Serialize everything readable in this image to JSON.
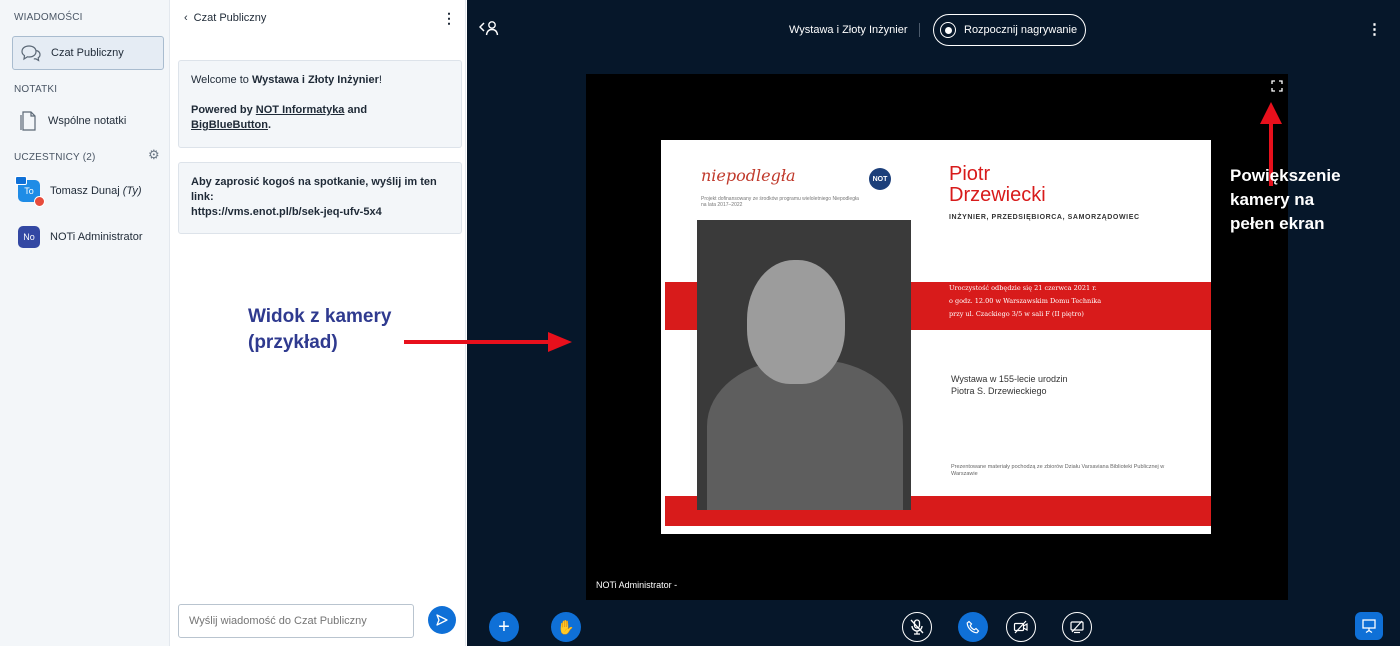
{
  "sidebar": {
    "messages_title": "WIADOMOŚCI",
    "public_chat_label": "Czat Publiczny",
    "notes_title": "NOTATKI",
    "shared_notes_label": "Wspólne notatki",
    "participants_title": "UCZESTNICY (2)",
    "participants": [
      {
        "initials": "To",
        "name": "Tomasz Dunaj",
        "suffix": "(Ty)",
        "color": "#1f8ce6"
      },
      {
        "initials": "No",
        "name": "NOTi Administrator",
        "suffix": "",
        "color": "#3348a3"
      }
    ]
  },
  "chat": {
    "header": "Czat Publiczny",
    "welcome_prefix": "Welcome to ",
    "welcome_name": "Wystawa i Złoty Inżynier",
    "welcome_suffix": "!",
    "powered_prefix": "Powered by ",
    "powered_link1": "NOT Informatyka",
    "powered_and": " and",
    "powered_link2": "BigBlueButton",
    "powered_end": ".",
    "invite_text": "Aby zaprosić kogoś na spotkanie, wyślij im ten link:",
    "invite_link": "https://vms.enot.pl/b/sek-jeq-ufv-5x4",
    "input_placeholder": "Wyślij wiadomość do Czat Publiczny"
  },
  "main": {
    "meeting_title": "Wystawa i Złoty Inżynier",
    "record_label": "Rozpocznij nagrywanie",
    "camera_label": "NOTi Administrator -"
  },
  "slide": {
    "logo_script": "niepodległa",
    "logo_sub": "Projekt dofinansowany ze środków programu wieloletniego Niepodległa na lata 2017–2022",
    "badge": "NOT",
    "name_line1": "Piotr",
    "name_line2": "Drzewiecki",
    "role": "INŻYNIER, PRZEDSIĘBIORCA, SAMORZĄDOWIEC",
    "event_line1": "Uroczystość odbędzie się 21 czerwca 2021 r.",
    "event_line2": "o godz. 12.00 w Warszawskim Domu Technika",
    "event_line3": "przy ul. Czackiego 3/5 w sali F (II piętro)",
    "exhibit_line1": "Wystawa w 155-lecie urodzin",
    "exhibit_line2": "Piotra S. Drzewieckiego",
    "footer": "Prezentowane materiały pochodzą ze zbiorów Działu Varsaviana Biblioteki Publicznej w Warszawie"
  },
  "annotations": {
    "camera_view_line1": "Widok z kamery",
    "camera_view_line2": "(przykład)",
    "fullscreen_line1": "Powiększenie",
    "fullscreen_line2": "kamery na",
    "fullscreen_line3": "pełen ekran"
  },
  "colors": {
    "primary": "#0f70d7",
    "main_bg": "#06172a",
    "annotation_arrow": "#e8101c",
    "annotation_text": "#2f3a8f"
  }
}
